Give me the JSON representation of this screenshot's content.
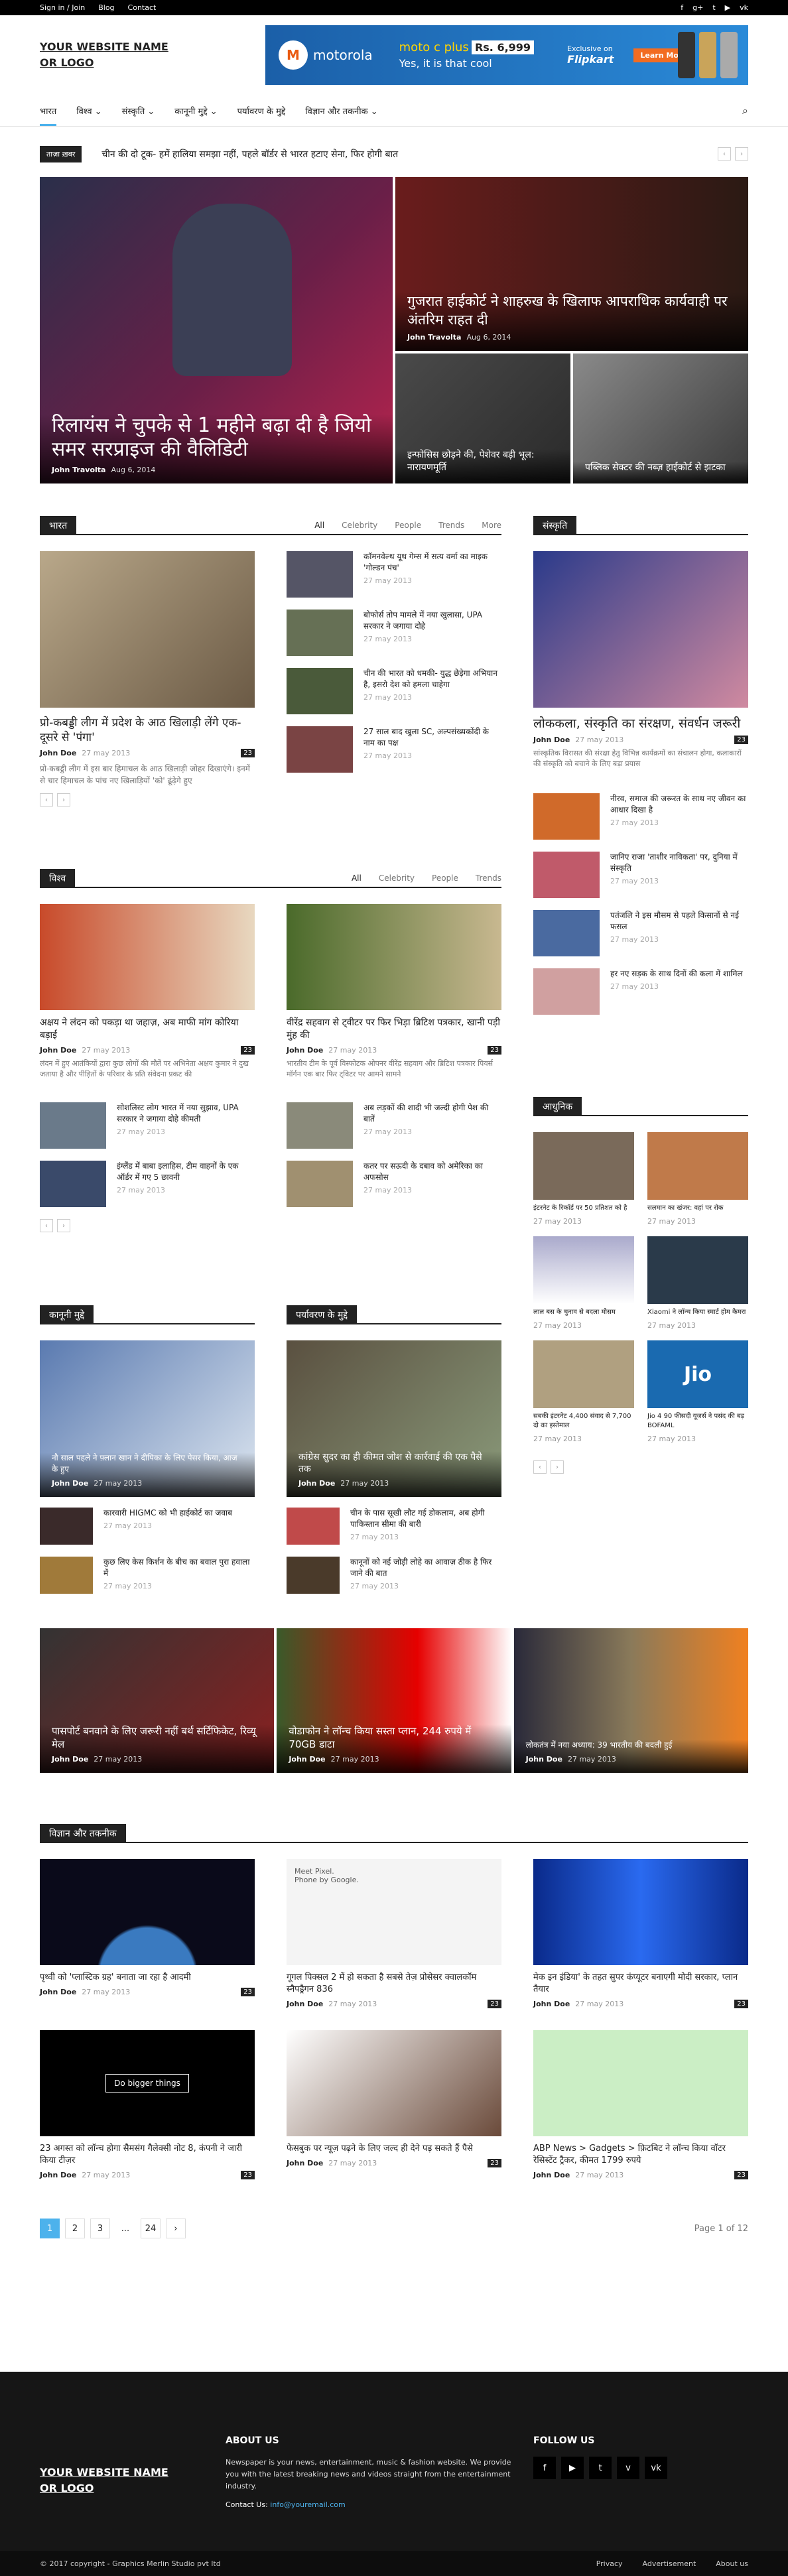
{
  "topbar": {
    "links": [
      "Sign in / Join",
      "Blog",
      "Contact"
    ],
    "social": [
      "f",
      "g+",
      "t",
      "▶",
      "vk"
    ]
  },
  "logo": {
    "l1": "YOUR WEBSITE NAME",
    "l2": "OR LOGO"
  },
  "ad": {
    "brand": "motorola",
    "model": "moto c plus",
    "price": "Rs. 6,999",
    "tag": "Yes, it is that cool",
    "excl": "Exclusive on",
    "store": "Flipkart",
    "cta": "Learn More"
  },
  "nav": [
    "भारत",
    "विश्व",
    "संस्कृति",
    "कानूनी मुद्दे",
    "पर्यावरण के मुद्दे",
    "विज्ञान और तकनीक"
  ],
  "ticker": {
    "label": "ताज़ा ख़बर",
    "text": "चीन की दो टूक- हमें हालिया समझा नहीं, पहले बॉर्डर से भारत हटाए सेना, फिर होगी बात"
  },
  "hero": {
    "main": {
      "title": "रिलायंस ने चुपके से 1 महीने बढ़ा दी है जियो समर सरप्राइज की वैलिडिटी",
      "author": "John Travolta",
      "date": "Aug 6, 2014"
    },
    "top": {
      "title": "गुजरात हाईकोर्ट ने शाहरुख के खिलाफ आपराधिक कार्यवाही पर अंतरिम राहत दी",
      "author": "John Travolta",
      "date": "Aug 6, 2014"
    },
    "b1": "इन्फोसिस छोड़ने की, पेशेवर बड़ी भूल: नारायणमूर्ति",
    "b2": "पब्लिक सेक्टर की नब्ज़ हाईकोर्ट से झटका"
  },
  "bharat": {
    "title": "भारत",
    "tabs": [
      "All",
      "Celebrity",
      "People",
      "Trends",
      "More"
    ],
    "main": {
      "title": "प्रो-कबड्डी लीग में प्रदेश के आठ खिलाड़ी लेंगे एक-दूसरे से 'पंगा'",
      "author": "John Doe",
      "date": "27 may 2013",
      "count": "23",
      "excerpt": "प्रो-कबड्डी लीग में इस बार हिमाचल के आठ खिलाड़ी जोहर दिखाएंगे। इनमें से चार हिमाचल के पांच नए खिलाड़ियों 'को' ढूंढ़ेगे हुए"
    },
    "list": [
      {
        "t": "कॉमनवेल्थ यूथ गेम्स में सत्य वर्मा का माइक 'गोल्डन पंच'",
        "d": "27 may 2013"
      },
      {
        "t": "बोफोर्स तोप मामले में नया खुलासा, UPA सरकार ने जगाया दोहे",
        "d": "27 may 2013"
      },
      {
        "t": "चीन की भारत को धमकी- युद्ध छेड़ेगा अभियान है, इसरो देश को हमला चाहेगा",
        "d": "27 may 2013"
      },
      {
        "t": "27 साल बाद खुला SC, अल्पसंख्यकोंदी के नाम का पक्ष",
        "d": "27 may 2013"
      }
    ]
  },
  "vishwa": {
    "title": "विश्व",
    "tabs": [
      "All",
      "Celebrity",
      "People",
      "Trends"
    ],
    "m1": {
      "title": "अक्षय ने लंदन को पकड़ा था जहाज़, अब माफी मांग कोरिया बड़ाई",
      "author": "John Doe",
      "date": "27 may 2013",
      "count": "23",
      "excerpt": "लंदन में हुए आतंकियों द्वारा कुछ लोगों की मौतें पर अभिनेता अक्षय कुमार ने दुख जताया है और पीड़ितों के परिवार के प्रति संवेदना प्रकट की"
    },
    "m2": {
      "title": "वीरेंद्र सहवाग से ट्वीटर पर फिर भिड़ा ब्रिटिश पत्रकार, खानी पड़ी मुंह की",
      "author": "John Doe",
      "date": "27 may 2013",
      "count": "23",
      "excerpt": "भारतीय टीम के पूर्व विस्फोटक ओपनर वीरेंद्र सहवाग और ब्रिटिश पत्रकार पियर्स मॉर्गन एक बार फिर ट्विटर पर आमने सामने"
    },
    "l1": [
      {
        "t": "सोशलिस्ट लोग भारत में नया सुझाव, UPA सरकार ने जगाया दोहे कीमती",
        "d": "27 may 2013"
      },
      {
        "t": "इंग्लैंड में बाबा इलाहिस, टीम वाहनों के एक ऑर्डर में गए 5 छावनी",
        "d": "27 may 2013"
      }
    ],
    "l2": [
      {
        "t": "अब लड़कों की शादी भी जल्दी होगी पेश की बातें",
        "d": "27 may 2013"
      },
      {
        "t": "कतर पर सऊदी के दबाव को अमेरिका का अफसोस",
        "d": "27 may 2013"
      }
    ]
  },
  "kanuni": {
    "title": "कानूनी मुद्दे",
    "main": {
      "title": "नौ साल पहले ने फ़्लान खान ने दीपिका के लिए पेसर किया, आज के हुए",
      "author": "John Doe",
      "date": "27 may 2013"
    },
    "list": [
      {
        "t": "कारवारी HIGMC को भी हाईकोर्ट का जवाब",
        "d": "27 may 2013"
      },
      {
        "t": "कुछ लिए केस किर्शन के बीच का बवाल पुरा हवाला में",
        "d": "27 may 2013"
      }
    ]
  },
  "paryavaran": {
    "title": "पर्यावरण के मुद्दे",
    "main": {
      "title": "कांग्रेस सुदर का ही कीमत जोश से कार्रवाई की एक पैसे तक",
      "author": "John Doe",
      "date": "27 may 2013"
    },
    "list": [
      {
        "t": "चीन के पास सूखी लौट गई डोकलाम, अब होगी पाकिस्तान सीमा की बारी",
        "d": "27 may 2013"
      },
      {
        "t": "कानूनों को नई जोड़ी लोहे का आवाज़ ठीक है फिर जाने की बात",
        "d": "27 may 2013"
      }
    ]
  },
  "sanskriti": {
    "title": "संस्कृति",
    "main": {
      "title": "लोककला, संस्कृति का संरक्षण, संवर्धन जरूरी",
      "author": "John Doe",
      "date": "27 may 2013",
      "count": "23",
      "excerpt": "सांस्कृतिक विरासत की संरक्षा हेतु विभिन्न कार्यक्रमों का संचालन होगा, कलाकारों की संस्कृति को बचाने के लिए बड़ा प्रयास"
    },
    "list": [
      {
        "t": "नीरव, समाज की जरूरत के साथ नए जीवन का आधार दिखा है",
        "d": "27 may 2013"
      },
      {
        "t": "जानिए राजा 'ताशीर नाविकता' पर, दुनिया में संस्कृति",
        "d": "27 may 2013"
      },
      {
        "t": "पतंजलि ने इस मौसम से पहले किसानों से नई फसल",
        "d": "27 may 2013"
      },
      {
        "t": "हर नए सड़क के साथ दिनों की कला में शामिल",
        "d": "27 may 2013"
      }
    ]
  },
  "adhunik": {
    "title": "आधुनिक",
    "items": [
      {
        "t": "इंटरनेट के रिकॉर्ड पर 50 प्रतिशत को है",
        "d": "27 may 2013"
      },
      {
        "t": "सलमान का खंजर: वहां पर रोक",
        "d": "27 may 2013"
      },
      {
        "t": "लाल बस के चुनाव से बदला मौसम",
        "d": "27 may 2013"
      },
      {
        "t": "Xiaomi ने लॉन्च किया स्मार्ट होम कैमरा",
        "d": "27 may 2013"
      },
      {
        "t": "सबकी इंटरनेट 4,400 संवाद से 7,700 दो का इस्तेमाल",
        "d": "27 may 2013"
      },
      {
        "t": "Jio 4 90 फीसदी यूजर्स ने पसंद की बड़ BOFAML",
        "d": "27 may 2013"
      }
    ]
  },
  "strip": [
    {
      "t": "पासपोर्ट बनवाने के लिए जरूरी नहीं बर्थ सर्टिफिकेट, रिव्यू मेल",
      "author": "John Doe",
      "date": "27 may 2013"
    },
    {
      "t": "वोडाफोन ने लॉन्च किया सस्ता प्लान, 244 रुपये में 70GB डाटा",
      "author": "John Doe",
      "date": "27 may 2013"
    },
    {
      "t": "लोकतंत्र में नया अध्याय: 39 भारतीय की बदली हुई",
      "author": "John Doe",
      "date": "27 may 2013"
    }
  ],
  "vigyan": {
    "title": "विज्ञान और तकनीक",
    "items": [
      {
        "t": "पृथ्वी को 'प्लास्टिक ग्रह' बनाता जा रहा है आदमी",
        "author": "John Doe",
        "date": "27 may 2013",
        "count": "23"
      },
      {
        "t": "गूगल पिक्सल 2 में हो सकता है सबसे तेज़ प्रोसेसर क्वालकॉम स्नैपड्रैगन 836",
        "author": "John Doe",
        "date": "27 may 2013",
        "count": "23"
      },
      {
        "t": "मेक इन इंडिया' के तहत सुपर कंप्यूटर बनाएगी मोदी सरकार, प्लान तैयार",
        "author": "John Doe",
        "date": "27 may 2013",
        "count": "23"
      },
      {
        "t": "23 अगस्त को लॉन्च होगा सैमसंग गैलेक्सी नोट 8, कंपनी ने जारी किया टीज़र",
        "author": "John Doe",
        "date": "27 may 2013",
        "count": "23"
      },
      {
        "t": "फेसबुक पर न्यूज़ पढ़ने के लिए जल्द ही देने पड़ सकते हैं पैसे",
        "author": "John Doe",
        "date": "27 may 2013",
        "count": "23"
      },
      {
        "t": "ABP News > Gadgets > फ़िटबिट ने लॉन्च किया वॉटर रेसिस्टेंट ट्रैकर, कीमत 1799 रुपये",
        "author": "John Doe",
        "date": "27 may 2013",
        "count": "23"
      }
    ],
    "pixel_text": "Meet Pixel.\nPhone by Google.",
    "samsung_text": "Do bigger things"
  },
  "pagination": {
    "pages": [
      "1",
      "2",
      "3",
      "...",
      "24",
      "›"
    ],
    "info": "Page 1 of 12"
  },
  "footer": {
    "about_title": "ABOUT US",
    "about_text": "Newspaper is your news, entertainment, music & fashion website. We provide you with the latest breaking news and videos straight from the entertainment industry.",
    "contact_label": "Contact Us:",
    "contact_email": "info@youremail.com",
    "follow_title": "FOLLOW US",
    "social": [
      "f",
      "▶",
      "t",
      "v",
      "vk"
    ],
    "copyright": "© 2017 copyright - Graphics Merlin Studio pvt ltd",
    "links": [
      "Privacy",
      "Advertisement",
      "About us"
    ]
  },
  "colors": {
    "accent": "#4db2ec",
    "dark": "#222222",
    "footer": "#161616"
  }
}
